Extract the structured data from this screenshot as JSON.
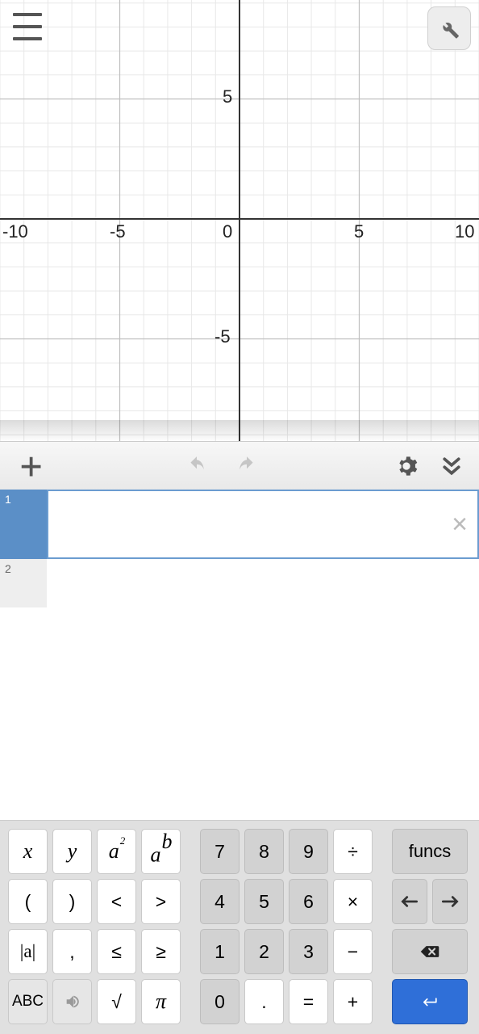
{
  "chart_data": {
    "type": "scatter",
    "title": "",
    "xlabel": "",
    "ylabel": "",
    "xlim": [
      -10,
      10
    ],
    "ylim": [
      -9,
      9
    ],
    "x_ticks": [
      -10,
      -5,
      0,
      5,
      10
    ],
    "y_ticks": [
      -5,
      5
    ],
    "minor_grid_step": 1,
    "series": []
  },
  "expressions": {
    "row1_index": "1",
    "row1_value": "",
    "row2_index": "2"
  },
  "keypad": {
    "x": "x",
    "y": "y",
    "asq_base": "a",
    "asq_exp": "2",
    "apow_base": "a",
    "apow_exp": "b",
    "lp": "(",
    "rp": ")",
    "lt": "<",
    "gt": ">",
    "abs": "|a|",
    "comma": ",",
    "le": "≤",
    "ge": "≥",
    "abc": "ABC",
    "sqrt": "√",
    "pi": "π",
    "d7": "7",
    "d8": "8",
    "d9": "9",
    "div": "÷",
    "d4": "4",
    "d5": "5",
    "d6": "6",
    "mul": "×",
    "d1": "1",
    "d2": "2",
    "d3": "3",
    "minus": "−",
    "d0": "0",
    "dot": ".",
    "eq": "=",
    "plus": "+",
    "funcs": "funcs",
    "arrow_left": "←",
    "arrow_right": "→"
  }
}
